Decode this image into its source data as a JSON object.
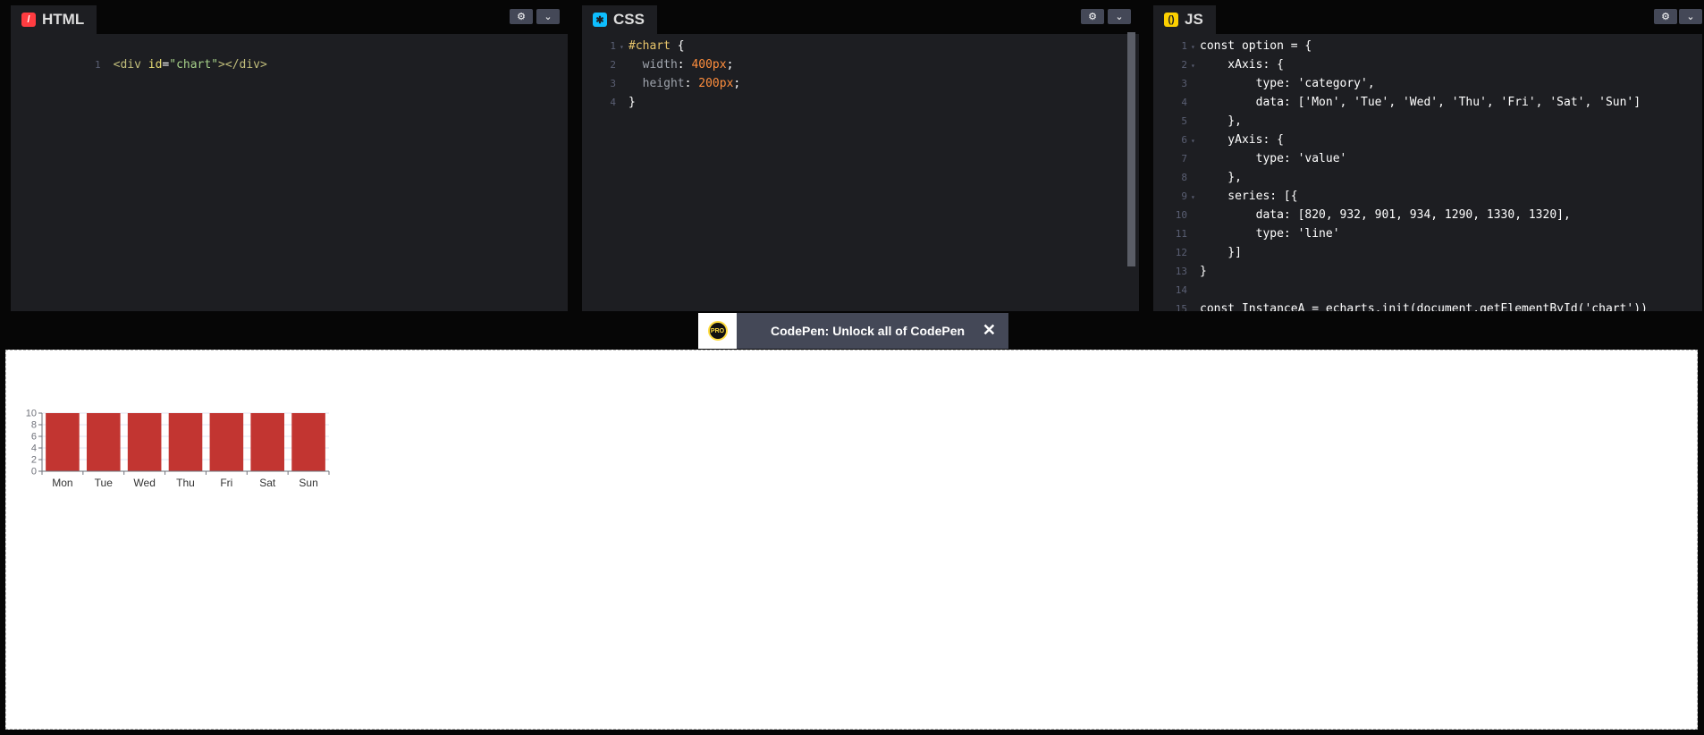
{
  "html_pane": {
    "title": "HTML",
    "icon": "html-icon",
    "accent": "#ff3c41",
    "line": {
      "num": "1",
      "open_tag": "<div",
      "attr": "id",
      "value": "\"chart\"",
      "close": "></div>"
    }
  },
  "css_pane": {
    "title": "CSS",
    "icon": "css-icon",
    "accent": "#0ebeff",
    "lines": [
      {
        "num": "1",
        "selector": "#chart",
        "rest": " {"
      },
      {
        "num": "2",
        "prop": "width",
        "val": "400px"
      },
      {
        "num": "3",
        "prop": "height",
        "val": "200px"
      },
      {
        "num": "4",
        "text": "}"
      }
    ]
  },
  "js_pane": {
    "title": "JS",
    "icon": "js-icon",
    "accent": "#fcd000",
    "lines": [
      {
        "num": "1",
        "text": "const option = {"
      },
      {
        "num": "2",
        "text": "    xAxis: {"
      },
      {
        "num": "3",
        "text": "        type: 'category',"
      },
      {
        "num": "4",
        "text": "        data: ['Mon', 'Tue', 'Wed', 'Thu', 'Fri', 'Sat', 'Sun']"
      },
      {
        "num": "5",
        "text": "    },"
      },
      {
        "num": "6",
        "text": "    yAxis: {"
      },
      {
        "num": "7",
        "text": "        type: 'value'"
      },
      {
        "num": "8",
        "text": "    },"
      },
      {
        "num": "9",
        "text": "    series: [{"
      },
      {
        "num": "10",
        "text": "        data: [820, 932, 901, 934, 1290, 1330, 1320],"
      },
      {
        "num": "11",
        "text": "        type: 'line'"
      },
      {
        "num": "12",
        "text": "    }]"
      },
      {
        "num": "13",
        "text": "}"
      },
      {
        "num": "14",
        "text": ""
      },
      {
        "num": "15",
        "text": "const InstanceA = echarts.init(document.getElementById('chart'))"
      }
    ]
  },
  "banner": {
    "text": "CodePen: Unlock all of CodePen",
    "logo": "PRO",
    "close": "✕"
  },
  "chart_data": {
    "type": "bar",
    "categories": [
      "Mon",
      "Tue",
      "Wed",
      "Thu",
      "Fri",
      "Sat",
      "Sun"
    ],
    "values": [
      10,
      10,
      10,
      10,
      10,
      10,
      10
    ],
    "yticks": [
      "0",
      "2",
      "4",
      "6",
      "8",
      "10"
    ],
    "ylim": [
      0,
      10
    ],
    "bar_color": "#c23531",
    "grid": true
  }
}
